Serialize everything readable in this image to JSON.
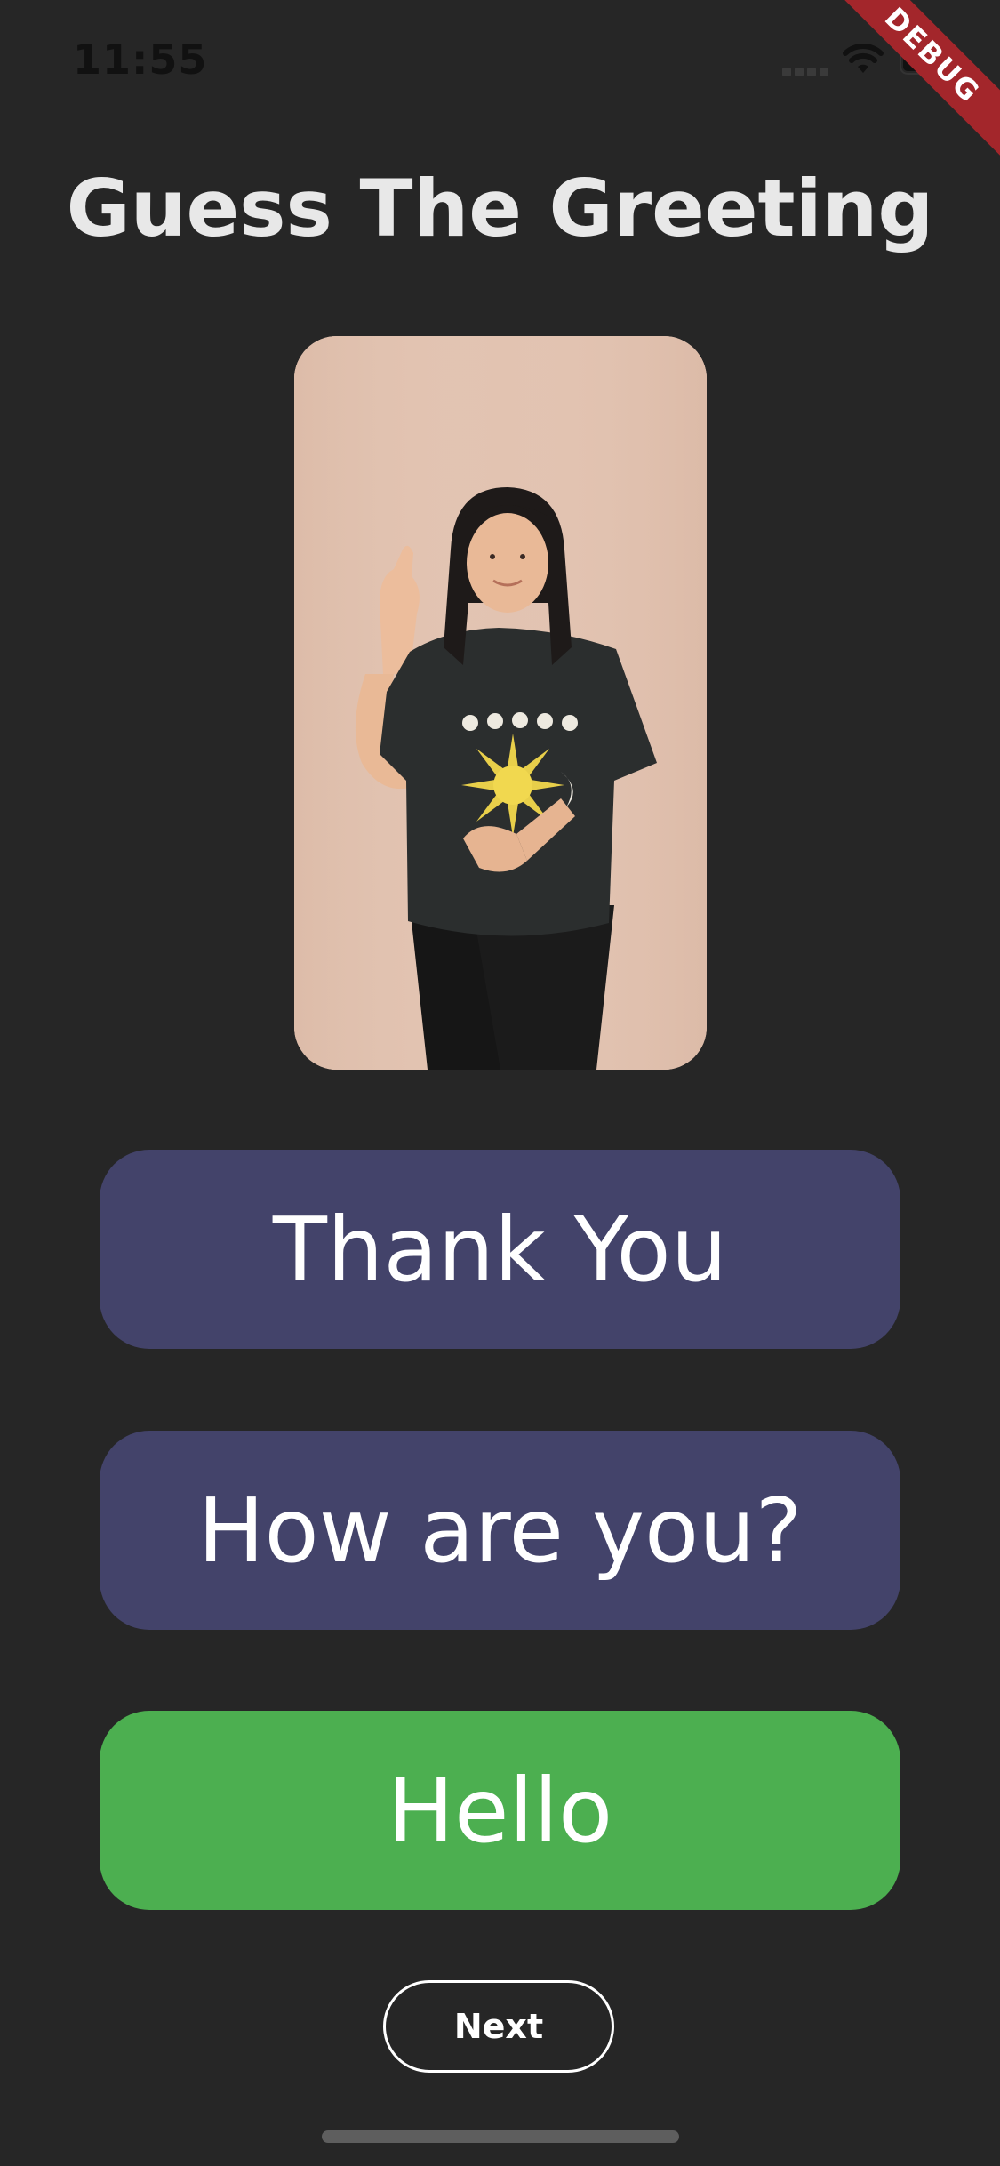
{
  "status_bar": {
    "time": "11:55"
  },
  "debug_banner": "DEBUG",
  "title": "Guess The Greeting",
  "photo": {
    "icon": "person-signing-photo"
  },
  "options": [
    {
      "label": "Thank You",
      "color": "#43436a"
    },
    {
      "label": "How are you?",
      "color": "#43436a"
    },
    {
      "label": "Hello",
      "color": "#4caf50"
    }
  ],
  "next_label": "Next",
  "colors": {
    "background": "#262626",
    "option_default": "#43436a",
    "option_correct": "#4caf50",
    "ribbon": "#a3262b"
  }
}
